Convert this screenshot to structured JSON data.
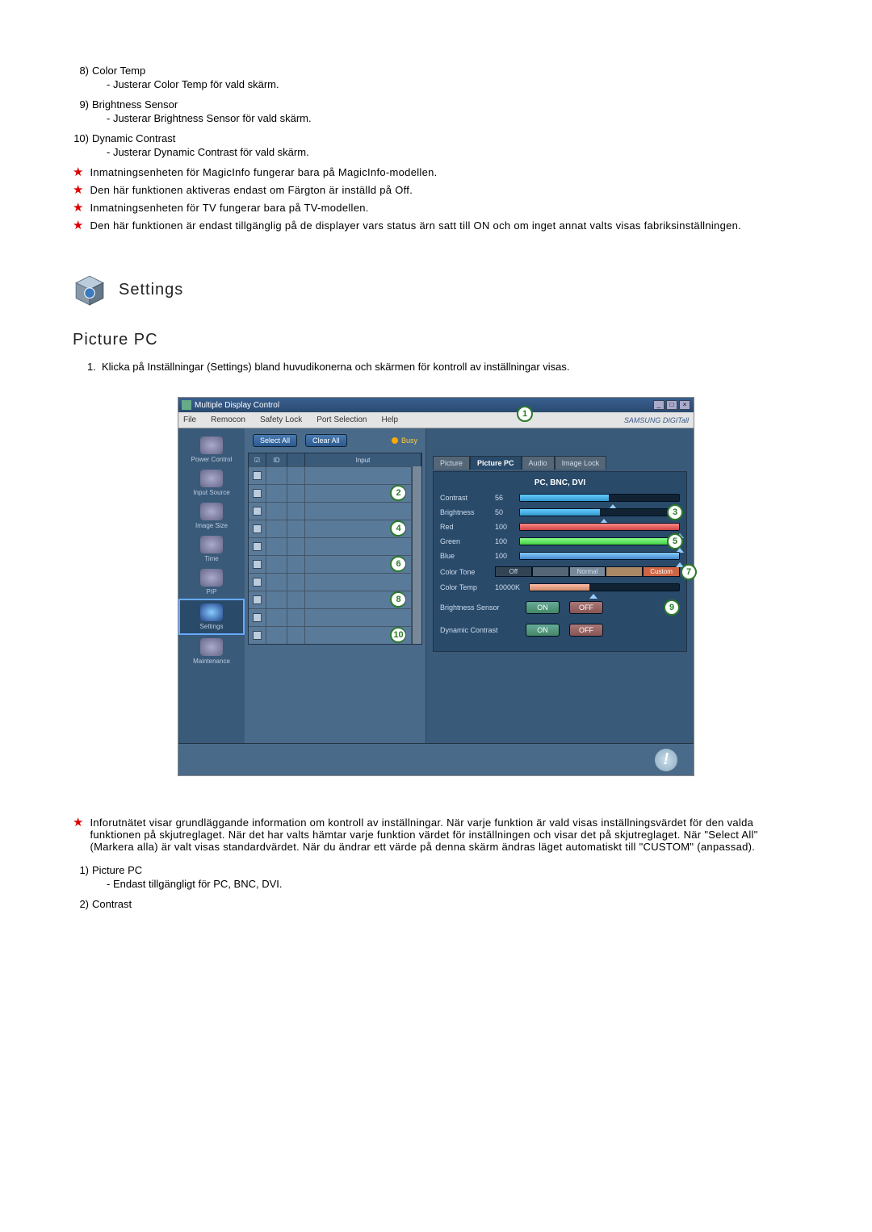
{
  "top_list": [
    {
      "num": "8)",
      "label": "Color Temp",
      "desc": "- Justerar Color Temp för vald skärm."
    },
    {
      "num": "9)",
      "label": "Brightness Sensor",
      "desc": "- Justerar Brightness Sensor för vald skärm."
    },
    {
      "num": "10)",
      "label": "Dynamic Contrast",
      "desc": "- Justerar Dynamic Contrast för vald skärm."
    }
  ],
  "stars": [
    "Inmatningsenheten för MagicInfo fungerar bara på MagicInfo-modellen.",
    "Den här funktionen aktiveras endast om Färgton är inställd på Off.",
    "Inmatningsenheten för TV fungerar bara på TV-modellen.",
    "Den här funktionen är endast tillgänglig på de displayer vars status ärn satt till ON och om inget annat valts visas fabriksinställningen."
  ],
  "settings_title": "Settings",
  "section_title": "Picture PC",
  "intro_step": {
    "n": "1.",
    "t": "Klicka på Inställningar (Settings) bland huvudikonerna och skärmen för kontroll av inställningar visas."
  },
  "app": {
    "window_title": "Multiple Display Control",
    "menu": {
      "file": "File",
      "remocon": "Remocon",
      "safety": "Safety Lock",
      "port": "Port Selection",
      "help": "Help",
      "brand": "SAMSUNG DIGITall"
    },
    "buttons": {
      "select_all": "Select All",
      "clear_all": "Clear All",
      "busy": "Busy"
    },
    "grid_headers": {
      "chk": "☑",
      "id": "ID",
      "st": "",
      "input": "Input"
    },
    "sidebar": [
      {
        "name": "power-control",
        "label": "Power Control"
      },
      {
        "name": "input-source",
        "label": "Input Source"
      },
      {
        "name": "image-size",
        "label": "Image Size"
      },
      {
        "name": "time",
        "label": "Time"
      },
      {
        "name": "pip",
        "label": "PIP"
      },
      {
        "name": "settings",
        "label": "Settings",
        "selected": true
      },
      {
        "name": "maintenance",
        "label": "Maintenance"
      }
    ],
    "tabs": {
      "picture": "Picture",
      "picture_pc": "Picture PC",
      "audio": "Audio",
      "image_lock": "Image Lock"
    },
    "pane_title": "PC, BNC, DVI",
    "sliders": {
      "contrast": {
        "label": "Contrast",
        "value": "56"
      },
      "brightness": {
        "label": "Brightness",
        "value": "50"
      },
      "red": {
        "label": "Red",
        "value": "100"
      },
      "green": {
        "label": "Green",
        "value": "100"
      },
      "blue": {
        "label": "Blue",
        "value": "100"
      }
    },
    "color_tone": {
      "label": "Color Tone",
      "opts": {
        "off": "Off",
        "normal": "Normal",
        "custom": "Custom"
      }
    },
    "color_temp": {
      "label": "Color Temp",
      "value": "10000K"
    },
    "brightness_sensor": {
      "label": "Brightness Sensor",
      "on": "ON",
      "off": "OFF"
    },
    "dynamic_contrast": {
      "label": "Dynamic Contrast",
      "on": "ON",
      "off": "OFF"
    },
    "callouts": [
      "1",
      "2",
      "3",
      "4",
      "5",
      "6",
      "7",
      "8",
      "9",
      "10"
    ]
  },
  "below_star": "Inforutnätet visar grundläggande information om kontroll av inställningar. När varje funktion är vald visas inställningsvärdet för den valda funktionen på skjutreglaget. När det har valts hämtar varje funktion värdet för inställningen och visar det på skjutreglaget. När \"Select All\" (Markera alla) är valt visas standardvärdet. När du ändrar ett värde på denna skärm ändras läget automatiskt till \"CUSTOM\" (anpassad).",
  "below_list": [
    {
      "num": "1)",
      "label": "Picture PC",
      "desc": "- Endast tillgängligt för PC, BNC, DVI."
    },
    {
      "num": "2)",
      "label": "Contrast",
      "desc": ""
    }
  ]
}
